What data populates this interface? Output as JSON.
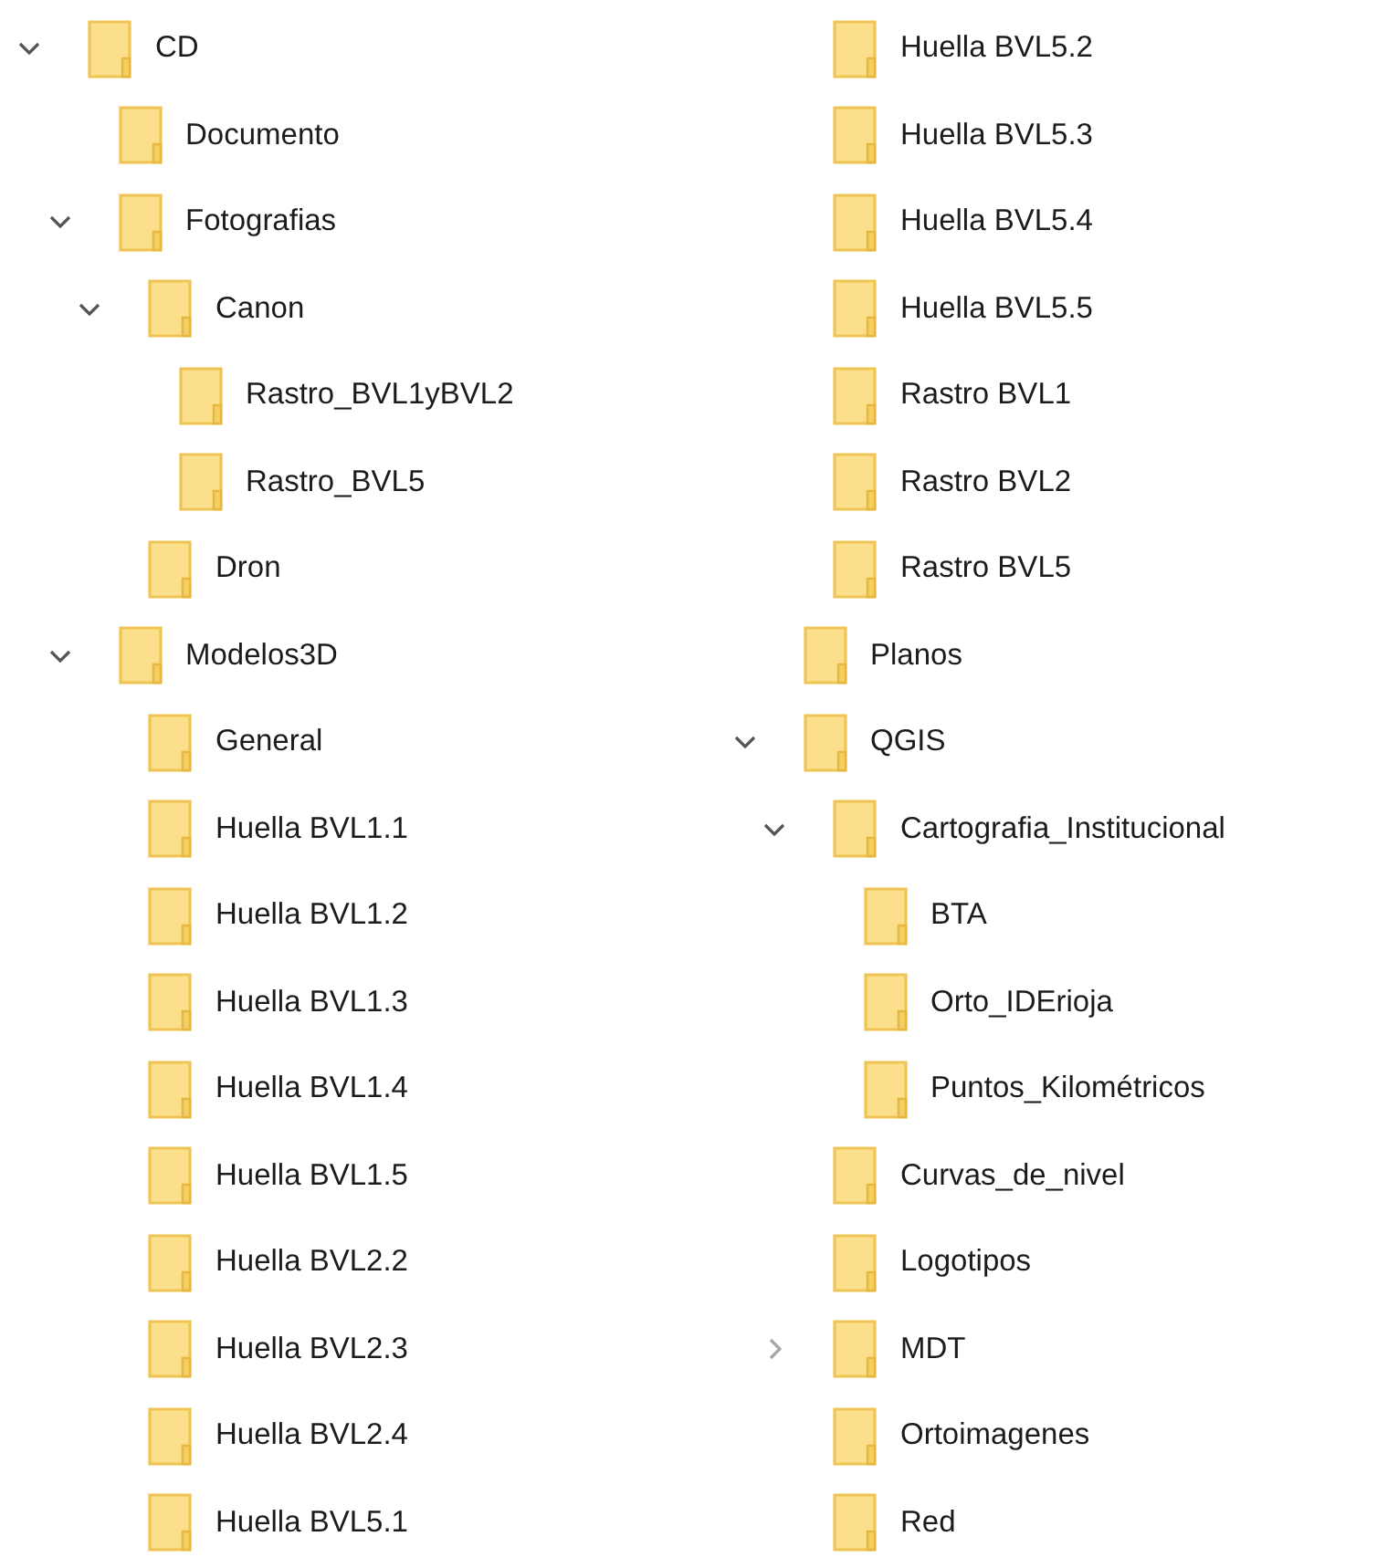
{
  "tree": [
    {
      "label": "CD",
      "expanded": true,
      "children": [
        {
          "label": "Documento"
        },
        {
          "label": "Fotografias",
          "expanded": true,
          "children": [
            {
              "label": "Canon",
              "expanded": true,
              "children": [
                {
                  "label": "Rastro_BVL1yBVL2"
                },
                {
                  "label": "Rastro_BVL5"
                }
              ]
            },
            {
              "label": "Dron"
            }
          ]
        },
        {
          "label": "Modelos3D",
          "expanded": true,
          "children": [
            {
              "label": "General"
            },
            {
              "label": "Huella BVL1.1"
            },
            {
              "label": "Huella BVL1.2"
            },
            {
              "label": "Huella BVL1.3"
            },
            {
              "label": "Huella BVL1.4"
            },
            {
              "label": "Huella BVL1.5"
            },
            {
              "label": "Huella BVL2.2"
            },
            {
              "label": "Huella BVL2.3"
            },
            {
              "label": "Huella BVL2.4"
            },
            {
              "label": "Huella BVL5.1"
            },
            {
              "label": "Huella BVL5.2"
            },
            {
              "label": "Huella BVL5.3"
            },
            {
              "label": "Huella BVL5.4"
            },
            {
              "label": "Huella BVL5.5"
            },
            {
              "label": "Rastro BVL1"
            },
            {
              "label": "Rastro BVL2"
            },
            {
              "label": "Rastro BVL5"
            }
          ]
        },
        {
          "label": "Planos"
        },
        {
          "label": "QGIS",
          "expanded": true,
          "children": [
            {
              "label": "Cartografia_Institucional",
              "expanded": true,
              "children": [
                {
                  "label": "BTA"
                },
                {
                  "label": "Orto_IDErioja"
                },
                {
                  "label": "Puntos_Kilométricos"
                }
              ]
            },
            {
              "label": "Curvas_de_nivel"
            },
            {
              "label": "Logotipos"
            },
            {
              "label": "MDT",
              "expanded": false
            },
            {
              "label": "Ortoimagenes"
            },
            {
              "label": "Red"
            }
          ]
        }
      ]
    }
  ]
}
